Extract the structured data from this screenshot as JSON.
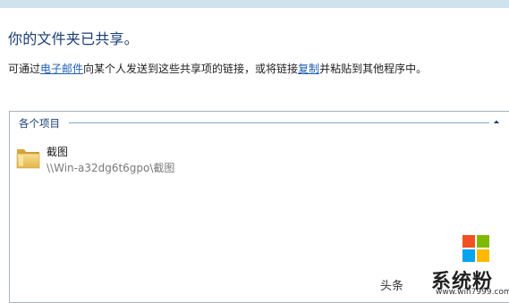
{
  "dialog": {
    "heading": "你的文件夹已共享。",
    "description_prefix": "可通过",
    "email_link": "电子邮件",
    "description_middle": "向某个人发送到这些共享项的链接，或将链接",
    "copy_link": "复制",
    "description_suffix": "并粘贴到其他程序中。"
  },
  "group": {
    "title": "各个项目",
    "collapse_icon": "chevron-up-icon"
  },
  "items": [
    {
      "name": "截图",
      "path": "\\\\Win-a32dg6t6gpo\\截图",
      "icon": "folder-icon"
    }
  ],
  "watermark": {
    "toutiao": "头条",
    "brand": "系统粉",
    "url": "www.win7999.com",
    "logo_colors": [
      "#f25022",
      "#7fba00",
      "#00a4ef",
      "#ffb900"
    ]
  },
  "colors": {
    "heading": "#1a3d73",
    "link": "#1c5fb0",
    "top_strip": "#cfe3ee"
  }
}
